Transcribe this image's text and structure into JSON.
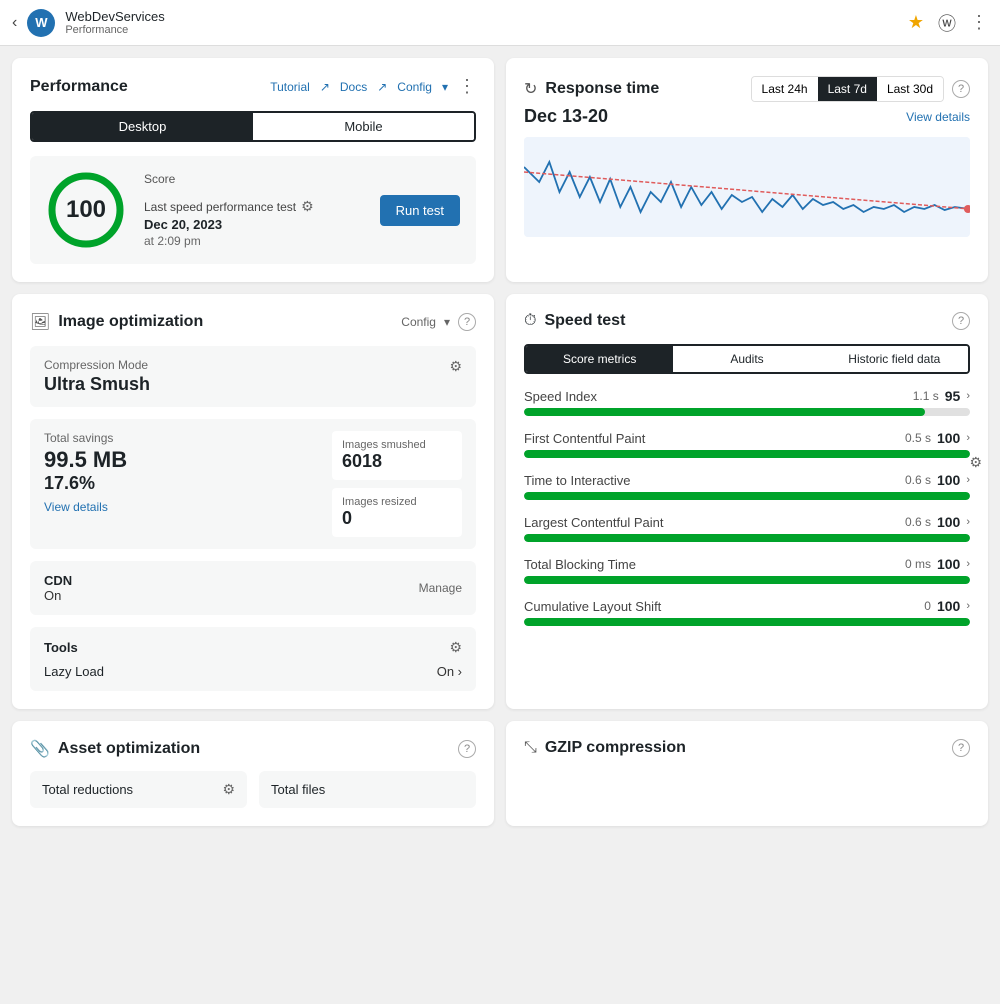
{
  "topbar": {
    "back_label": "‹",
    "avatar_letter": "W",
    "site_name": "WebDevServices",
    "site_sub": "Performance",
    "star_icon": "★",
    "wp_icon": "ⓦ",
    "dots_icon": "⋮"
  },
  "performance": {
    "title": "Performance",
    "tutorial_label": "Tutorial",
    "docs_label": "Docs",
    "config_label": "Config",
    "dots": "⋮",
    "toggle": {
      "desktop_label": "Desktop",
      "mobile_label": "Mobile"
    },
    "score": {
      "value": "100",
      "label": "Score"
    },
    "last_speed": {
      "title": "Last speed performance test",
      "date": "Dec 20, 2023",
      "time": "at 2:09 pm",
      "run_test_label": "Run test"
    }
  },
  "response_time": {
    "title": "Response time",
    "filters": [
      "Last 24h",
      "Last 7d",
      "Last 30d"
    ],
    "active_filter": "Last 7d",
    "date_range": "Dec 13-20",
    "view_details": "View details",
    "help_icon": "?"
  },
  "image_optimization": {
    "title": "Image optimization",
    "config_label": "Config",
    "help_icon": "?",
    "compression": {
      "label": "Compression Mode",
      "value": "Ultra Smush"
    },
    "total_savings": {
      "label": "Total savings",
      "amount": "99.5 MB",
      "percent": "17.6%",
      "view_details": "View details"
    },
    "images_smushed": {
      "label": "Images smushed",
      "value": "6018"
    },
    "images_resized": {
      "label": "Images resized",
      "value": "0"
    },
    "cdn": {
      "label": "CDN",
      "status": "On",
      "manage": "Manage"
    },
    "tools": {
      "label": "Tools",
      "lazy_load_label": "Lazy Load",
      "lazy_load_status": "On ›"
    }
  },
  "speed_test": {
    "title": "Speed test",
    "help_icon": "?",
    "tabs": [
      "Score metrics",
      "Audits",
      "Historic field data"
    ],
    "active_tab": "Score metrics",
    "metrics": [
      {
        "name": "Speed Index",
        "score": 95,
        "time": "1.1 s",
        "fill_pct": 90
      },
      {
        "name": "First Contentful Paint",
        "score": 100,
        "time": "0.5 s",
        "fill_pct": 100
      },
      {
        "name": "Time to Interactive",
        "score": 100,
        "time": "0.6 s",
        "fill_pct": 100
      },
      {
        "name": "Largest Contentful Paint",
        "score": 100,
        "time": "0.6 s",
        "fill_pct": 100
      },
      {
        "name": "Total Blocking Time",
        "score": 100,
        "time": "0 ms",
        "fill_pct": 100
      },
      {
        "name": "Cumulative Layout Shift",
        "score": 100,
        "time": "0",
        "fill_pct": 100
      }
    ]
  },
  "asset_optimization": {
    "title": "Asset optimization",
    "help_icon": "?",
    "col1_label": "Total reductions",
    "col2_label": "Total files"
  },
  "gzip": {
    "title": "GZIP compression",
    "help_icon": "?"
  }
}
